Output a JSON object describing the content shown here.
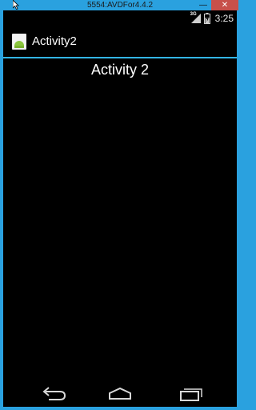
{
  "window": {
    "title": "5554:AVDFor4.4.2",
    "minimize_glyph": "—",
    "close_glyph": "✕"
  },
  "statusbar": {
    "network_label": "3G",
    "time": "3:25"
  },
  "actionbar": {
    "title": "Activity2"
  },
  "content": {
    "heading": "Activity 2"
  },
  "colors": {
    "frame": "#2aa1df",
    "screen_bg": "#000000",
    "accent": "#33b5e5"
  }
}
